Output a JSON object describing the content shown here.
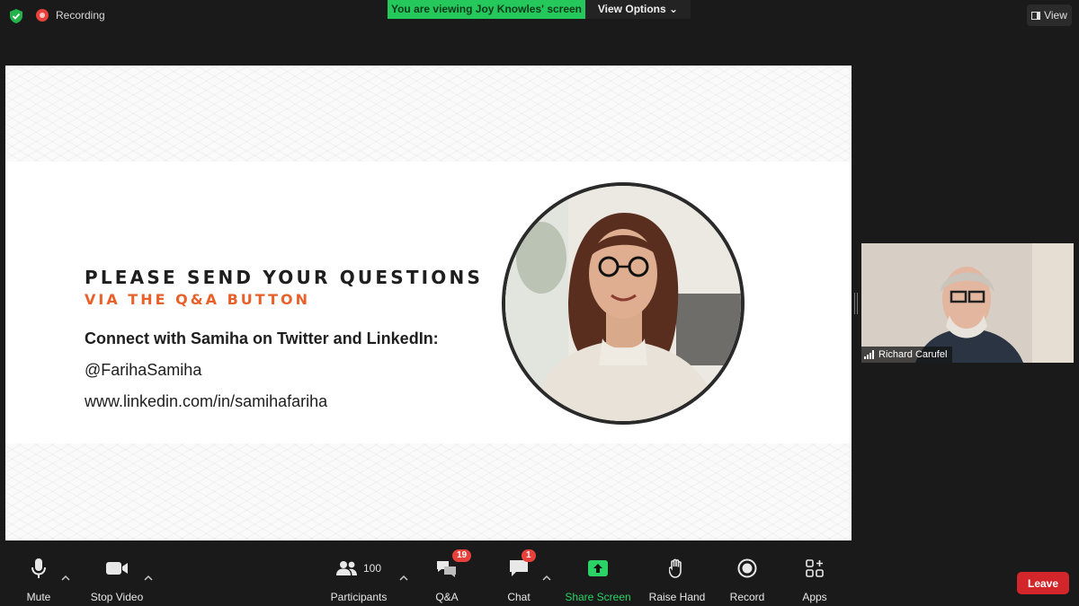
{
  "top": {
    "recording_label": "Recording",
    "viewing_banner": "You are viewing Joy Knowles' screen",
    "view_options_label": "View Options",
    "view_label": "View"
  },
  "slide": {
    "heading_line1": "PLEASE SEND YOUR QUESTIONS",
    "heading_line2": "VIA THE Q&A BUTTON",
    "connect_text": "Connect with Samiha on Twitter and LinkedIn:",
    "twitter_handle": "@FarihaSamiha",
    "linkedin_url": "www.linkedin.com/in/samihafariha",
    "accent_color": "#e8602a"
  },
  "speaker": {
    "name": "Richard Carufel"
  },
  "toolbar": {
    "mute_label": "Mute",
    "stop_video_label": "Stop Video",
    "participants_label": "Participants",
    "participants_count": "100",
    "qa_label": "Q&A",
    "qa_badge": "19",
    "chat_label": "Chat",
    "chat_badge": "1",
    "share_screen_label": "Share Screen",
    "raise_hand_label": "Raise Hand",
    "record_label": "Record",
    "apps_label": "Apps",
    "leave_label": "Leave",
    "share_color": "#2bd366",
    "leave_color": "#d3262b"
  }
}
